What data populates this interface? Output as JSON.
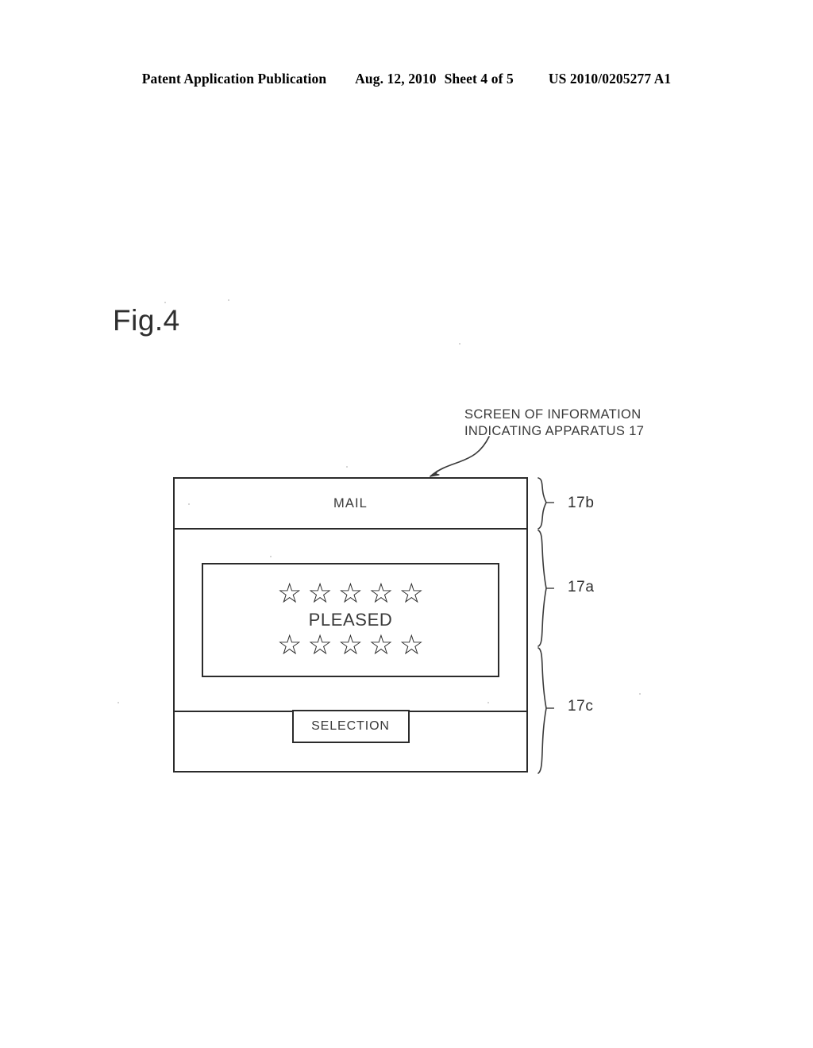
{
  "header": {
    "publication": "Patent Application Publication",
    "date": "Aug. 12, 2010",
    "sheet": "Sheet 4 of 5",
    "patent_number": "US 2010/0205277 A1"
  },
  "figure": {
    "label": "Fig.4"
  },
  "callout": {
    "line1": "SCREEN OF INFORMATION",
    "line2": "INDICATING APPARATUS 17"
  },
  "screen": {
    "title_bar": {
      "label": "MAIL"
    },
    "display_region": {
      "stars_top": [
        "☆",
        "☆",
        "☆",
        "☆",
        "☆"
      ],
      "message": "PLEASED",
      "stars_bottom": [
        "☆",
        "☆",
        "☆",
        "☆",
        "☆"
      ]
    },
    "operation_region": {
      "selection_label": "SELECTION"
    }
  },
  "brackets": {
    "title_bar_ref": "17b",
    "display_region_ref": "17a",
    "operation_region_ref": "17c"
  },
  "colors": {
    "ink": "#2b2b2b",
    "text": "#3a3a3a",
    "background": "#ffffff"
  }
}
